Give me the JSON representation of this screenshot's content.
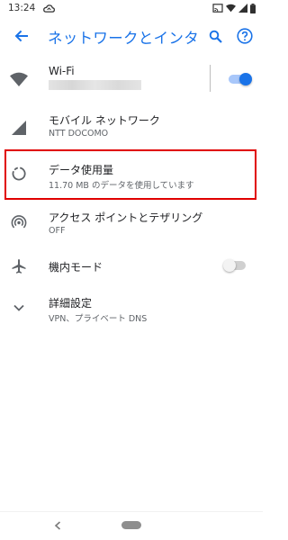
{
  "status_bar": {
    "time": "13:24",
    "icons": [
      "cloud-icon",
      "cast-icon",
      "wifi-status-icon",
      "signal-icon",
      "battery-icon"
    ]
  },
  "app_bar": {
    "title": "ネットワークとインターネット",
    "icons": [
      "back-arrow-icon",
      "search-icon",
      "help-icon"
    ],
    "accent_color": "#1a73e8"
  },
  "settings": {
    "wifi": {
      "title": "Wi-Fi",
      "enabled": true,
      "icon": "wifi-icon"
    },
    "mobile": {
      "title": "モバイル ネットワーク",
      "subtitle": "NTT DOCOMO",
      "icon": "signal-icon"
    },
    "data_usage": {
      "title": "データ使用量",
      "subtitle": "11.70 MB のデータを使用しています",
      "icon": "data-usage-icon",
      "highlighted": true,
      "highlight_color": "#e00000"
    },
    "hotspot": {
      "title": "アクセス ポイントとテザリング",
      "subtitle": "OFF",
      "icon": "hotspot-icon"
    },
    "airplane": {
      "title": "機内モード",
      "enabled": false,
      "icon": "airplane-icon"
    },
    "advanced": {
      "title": "詳細設定",
      "subtitle": "VPN、プライベート DNS",
      "icon": "chevron-down-icon"
    }
  },
  "nav_bar": {
    "icons": [
      "nav-back-icon",
      "nav-home-pill"
    ]
  }
}
